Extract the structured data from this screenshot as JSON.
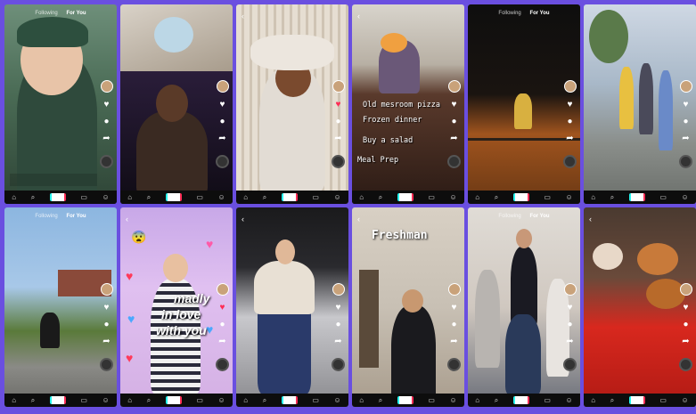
{
  "colors": {
    "frame": "#6a4fe0",
    "tabbar": "#0d0d0d",
    "tiktok_cyan": "#25f4ee",
    "tiktok_red": "#fe2c55"
  },
  "icons": {
    "back": "chevron-left-icon",
    "like": "heart-icon",
    "comment": "comment-icon",
    "share": "share-icon",
    "home": "home-icon",
    "search": "search-icon",
    "create": "plus-icon",
    "inbox": "inbox-icon",
    "profile": "profile-icon"
  },
  "nav": {
    "following": "Following",
    "for_you": "For You"
  },
  "tile_text": {
    "t4_line1": "Old mesroom pizza",
    "t4_line2": "Frozen dinner",
    "t4_line3": "Buy a salad",
    "t4_line4": "Meal Prep",
    "t8_line1": "madly",
    "t8_line2": "in love",
    "t8_line3": "with you",
    "t10_title": "Freshman"
  }
}
